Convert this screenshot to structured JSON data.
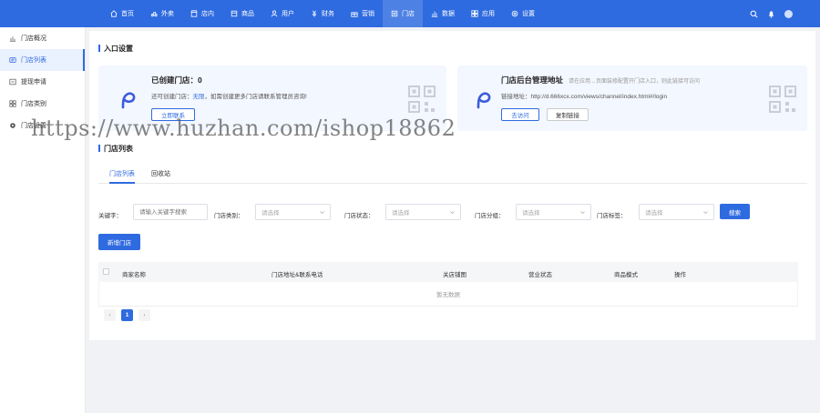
{
  "topnav": {
    "items": [
      {
        "label": "首页",
        "icon": "home-icon"
      },
      {
        "label": "外卖",
        "icon": "takeout-icon"
      },
      {
        "label": "店内",
        "icon": "store-icon"
      },
      {
        "label": "商品",
        "icon": "goods-icon"
      },
      {
        "label": "用户",
        "icon": "user-icon"
      },
      {
        "label": "财务",
        "icon": "finance-icon"
      },
      {
        "label": "营销",
        "icon": "gift-icon"
      },
      {
        "label": "门店",
        "icon": "shop-icon",
        "active": true
      },
      {
        "label": "数据",
        "icon": "data-icon"
      },
      {
        "label": "应用",
        "icon": "app-icon"
      },
      {
        "label": "设置",
        "icon": "gear-icon"
      }
    ]
  },
  "sidebar": {
    "items": [
      {
        "label": "门店概况",
        "icon": "chart-icon"
      },
      {
        "label": "门店列表",
        "icon": "list-icon",
        "active": true
      },
      {
        "label": "提现申请",
        "icon": "withdraw-icon",
        "expandable": true
      },
      {
        "label": "门店类别",
        "icon": "grid-icon",
        "expandable": true
      },
      {
        "label": "门店设置",
        "icon": "gear-icon"
      }
    ]
  },
  "entry": {
    "title": "入口设置",
    "card1": {
      "title": "已创建门店：0",
      "line_prefix": "还可创建门店：",
      "line_link": "无限",
      "line_suffix": "，如需创建更多门店请联系管理员咨询!",
      "button": "立即联系"
    },
    "card2": {
      "title": "门店后台管理地址",
      "hint": "请在应用→页面装修配置开门店入口，则此链接可访问",
      "url_label": "链接地址：",
      "url": "http://d.666xcx.com/views/channel/index.html#/login",
      "btn_visit": "去访问",
      "btn_copy": "复制链接"
    }
  },
  "list": {
    "title": "门店列表",
    "tabs": [
      "门店列表",
      "回收站"
    ],
    "filters": {
      "keyword_label": "关键字：",
      "keyword_placeholder": "请输入关键字搜索",
      "type_label": "门店类别：",
      "status_label": "门店状态：",
      "group_label": "门店分组：",
      "tag_label": "门店标签：",
      "select_placeholder": "请选择",
      "search_button": "搜索"
    },
    "add_button": "新增门店",
    "columns": [
      "商家名称",
      "门店地址&联系电话",
      "关店铺图",
      "营业状态",
      "商品模式",
      "操作"
    ],
    "empty_text": "暂无数据",
    "pager": {
      "prev": "‹",
      "page": "1",
      "next": "›"
    }
  },
  "watermark": "https://www.huzhan.com/ishop18862",
  "colors": {
    "primary": "#2f6be0",
    "card_bg": "#f3f7ff",
    "page_bg": "#f0f2f5"
  }
}
